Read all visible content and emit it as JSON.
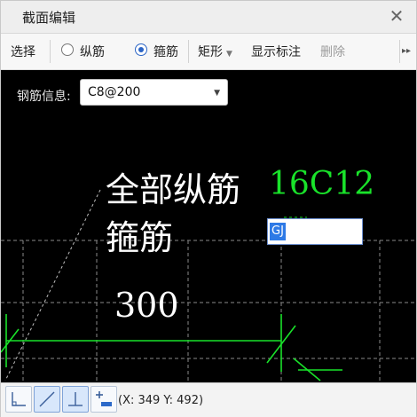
{
  "window": {
    "title": "截面编辑",
    "close_glyph": "✕"
  },
  "toolbar": {
    "select_label": "选择",
    "radio_longitudinal_label": "纵筋",
    "radio_stirrup_label": "箍筋",
    "shape_label": "矩形",
    "show_annotation_label": "显示标注",
    "delete_label": "删除",
    "selected_mode": "箍筋",
    "more_glyph": "▸▸"
  },
  "canvas": {
    "rebar_info_label": "钢筋信息:",
    "rebar_info_value": "C8@200",
    "all_longitudinal_label": "全部纵筋",
    "all_longitudinal_value": "16C12",
    "stirrup_label": "箍筋",
    "stirrup_edit_value": "GJ",
    "dimension_value": "300",
    "colors": {
      "background": "#000000",
      "text": "#ffffff",
      "green": "#19e22a"
    }
  },
  "statusbar": {
    "coordinates": "(X: 349  Y: 492)"
  }
}
